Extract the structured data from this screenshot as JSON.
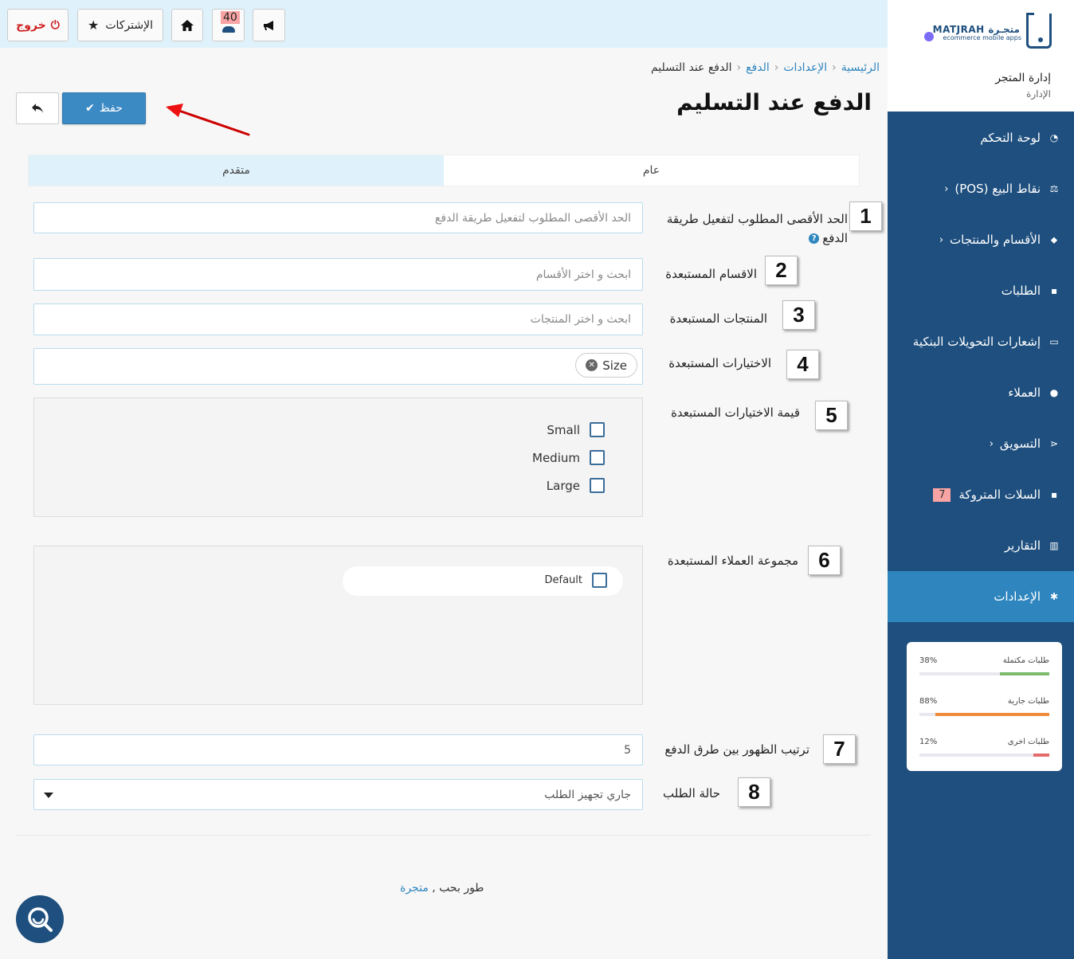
{
  "topbar": {
    "logout_label": "خروج",
    "subscriptions_label": "الإشتركات",
    "notifications_count": "40"
  },
  "brand": {
    "name": "MATJRAH متجـرة",
    "tagline": "ecommerce mobile apps",
    "store_title": "إدارة المتجر",
    "store_subtitle": "الإدارة"
  },
  "sidebar": {
    "items": [
      {
        "label": "لوحة التحكم",
        "icon": "dashboard-icon"
      },
      {
        "label": "نقاط البيع (POS)",
        "icon": "scale-icon",
        "chevron": "‹"
      },
      {
        "label": "الأقسام والمنتجات",
        "icon": "tag-icon",
        "chevron": "‹"
      },
      {
        "label": "الطلبات",
        "icon": "cart-icon"
      },
      {
        "label": "إشعارات التحويلات البنكية",
        "icon": "money-icon"
      },
      {
        "label": "العملاء",
        "icon": "user-icon"
      },
      {
        "label": "التسويق",
        "icon": "share-icon",
        "chevron": "‹"
      },
      {
        "label": "السلات المتروكة",
        "icon": "cart-icon",
        "count": "7"
      },
      {
        "label": "التقارير",
        "icon": "bar-chart-icon"
      },
      {
        "label": "الإعدادات",
        "icon": "gear-icon",
        "active": true
      }
    ]
  },
  "stats": [
    {
      "label": "طلبات مكتملة",
      "pct": "38%",
      "value": 0.38,
      "color": "#7dbb6e"
    },
    {
      "label": "طلبات جارية",
      "pct": "88%",
      "value": 0.88,
      "color": "#ef8c3a"
    },
    {
      "label": "طلبات اخرى",
      "pct": "12%",
      "value": 0.12,
      "color": "#e56b6b"
    }
  ],
  "breadcrumb": {
    "home": "الرئيسية",
    "settings": "الإعدادات",
    "payment": "الدفع",
    "current": "الدفع عند التسليم",
    "separator": "‹"
  },
  "page": {
    "title": "الدفع عند التسليم",
    "save_label": "حفظ"
  },
  "tabs": {
    "general": "عام",
    "advanced": "متقدم"
  },
  "form": {
    "max_amount": {
      "label": "الحد الأقصى المطلوب لتفعيل طريقة",
      "label2": "الدفع",
      "placeholder": "الحد الأقصى المطلوب لتفعيل طريقة الدفع",
      "badge": "1"
    },
    "excluded_categories": {
      "label": "الاقسام المستبعدة",
      "placeholder": "ابحث و اختر الأقسام",
      "badge": "2"
    },
    "excluded_products": {
      "label": "المنتجات المستبعدة",
      "placeholder": "ابحث و اختر المنتجات",
      "badge": "3"
    },
    "excluded_options": {
      "label": "الاختيارات المستبعدة",
      "tag": "Size",
      "badge": "4"
    },
    "excluded_option_values": {
      "label": "قيمة الاختيارات المستبعدة",
      "values": [
        "Small",
        "Medium",
        "Large"
      ],
      "badge": "5"
    },
    "excluded_customer_groups": {
      "label": "مجموعة العملاء المستبعدة",
      "values": [
        "Default"
      ],
      "badge": "6"
    },
    "sort_order": {
      "label": "ترتيب الظهور بين طرق الدفع",
      "value": "5",
      "badge": "7"
    },
    "order_status": {
      "label": "حالة الطلب",
      "value": "جاري تجهيز الطلب",
      "badge": "8"
    }
  },
  "footer": {
    "text": "طور بحب ,",
    "link": "متجرة"
  }
}
